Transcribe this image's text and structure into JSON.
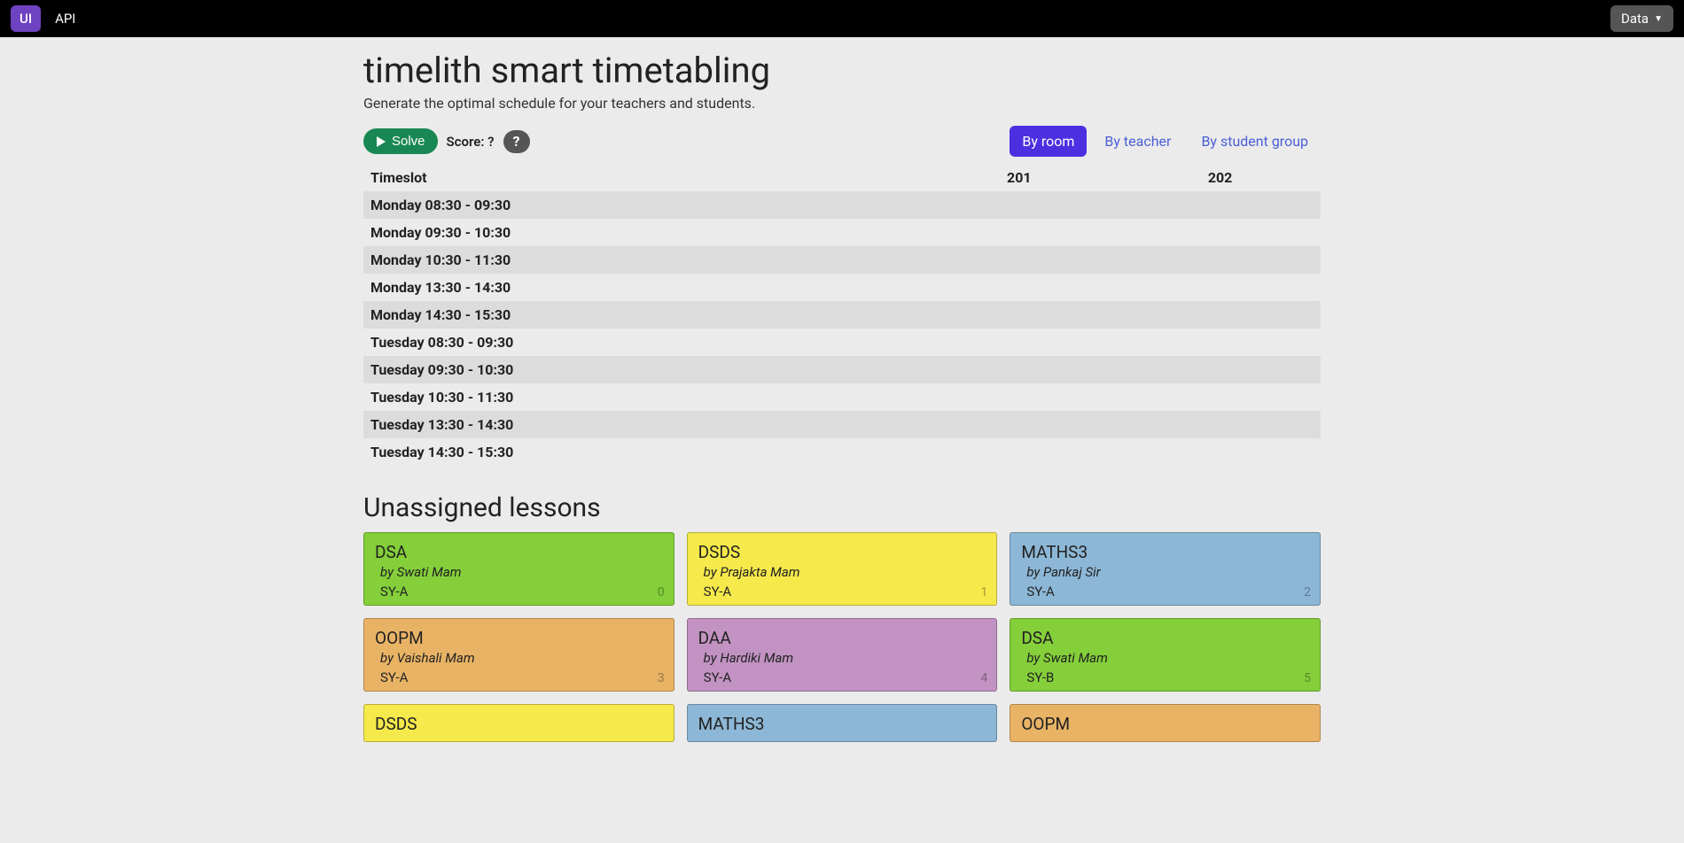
{
  "nav": {
    "ui": "UI",
    "api": "API",
    "data": "Data"
  },
  "header": {
    "title": "timelith smart timetabling",
    "subtitle": "Generate the optimal schedule for your teachers and students."
  },
  "controls": {
    "solve_label": "Solve",
    "score_label": "Score: ?",
    "help": "?"
  },
  "tabs": {
    "by_room": "By room",
    "by_teacher": "By teacher",
    "by_student_group": "By student group"
  },
  "table": {
    "timeslot_header": "Timeslot",
    "rooms": [
      "201",
      "202"
    ],
    "timeslots": [
      "Monday 08:30 - 09:30",
      "Monday 09:30 - 10:30",
      "Monday 10:30 - 11:30",
      "Monday 13:30 - 14:30",
      "Monday 14:30 - 15:30",
      "Tuesday 08:30 - 09:30",
      "Tuesday 09:30 - 10:30",
      "Tuesday 10:30 - 11:30",
      "Tuesday 13:30 - 14:30",
      "Tuesday 14:30 - 15:30"
    ]
  },
  "unassigned": {
    "title": "Unassigned lessons",
    "lessons": [
      {
        "subject": "DSA",
        "teacher": "by Swati Mam",
        "group": "SY-A",
        "id": "0",
        "color": "green"
      },
      {
        "subject": "DSDS",
        "teacher": "by Prajakta Mam",
        "group": "SY-A",
        "id": "1",
        "color": "yellow"
      },
      {
        "subject": "MATHS3",
        "teacher": "by Pankaj Sir",
        "group": "SY-A",
        "id": "2",
        "color": "blue"
      },
      {
        "subject": "OOPM",
        "teacher": "by Vaishali Mam",
        "group": "SY-A",
        "id": "3",
        "color": "orange"
      },
      {
        "subject": "DAA",
        "teacher": "by Hardiki Mam",
        "group": "SY-A",
        "id": "4",
        "color": "purple"
      },
      {
        "subject": "DSA",
        "teacher": "by Swati Mam",
        "group": "SY-B",
        "id": "5",
        "color": "green"
      },
      {
        "subject": "DSDS",
        "teacher": "",
        "group": "",
        "id": "",
        "color": "yellow"
      },
      {
        "subject": "MATHS3",
        "teacher": "",
        "group": "",
        "id": "",
        "color": "blue"
      },
      {
        "subject": "OOPM",
        "teacher": "",
        "group": "",
        "id": "",
        "color": "orange"
      }
    ]
  }
}
